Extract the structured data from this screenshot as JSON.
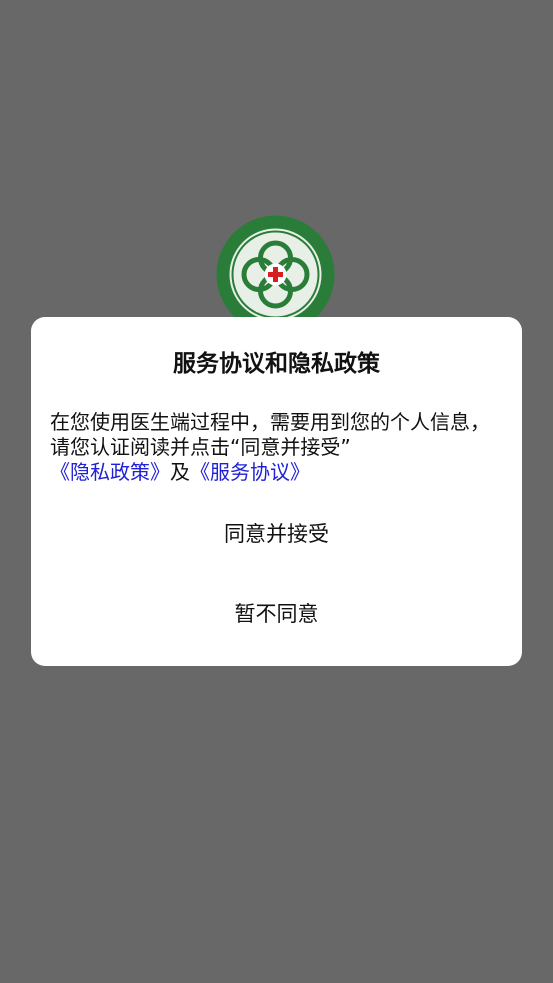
{
  "dialog": {
    "title": "服务协议和隐私政策",
    "body_text": "在您使用医生端过程中，需要用到您的个人信息，请您认证阅读并点击“同意并接受”",
    "privacy_link": "《隐私政策》",
    "conjunction": "及",
    "service_link": "《服务协议》",
    "accept_label": "同意并接受",
    "decline_label": "暂不同意"
  },
  "colors": {
    "overlay": "#686868",
    "link": "#2020d8",
    "logo_green": "#2e8b3e"
  }
}
